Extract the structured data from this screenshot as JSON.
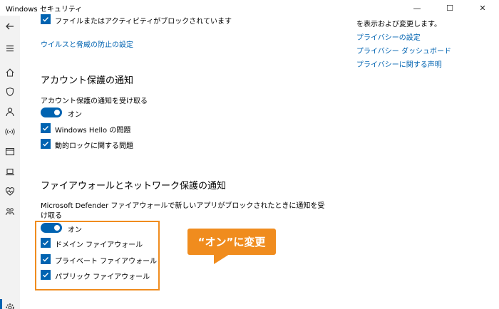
{
  "window": {
    "title": "Windows セキュリティ",
    "minimize": "—",
    "maximize": "☐",
    "close": "✕"
  },
  "top": {
    "blocked_activity_label": "ファイルまたはアクティビティがブロックされています",
    "virus_settings_link": "ウイルスと脅威の防止の設定"
  },
  "right_panel": {
    "description": "を表示および変更します。",
    "links": [
      "プライバシーの設定",
      "プライバシー ダッシュボード",
      "プライバシーに関する声明"
    ]
  },
  "account_section": {
    "heading": "アカウント保護の通知",
    "receive_label": "アカウント保護の通知を受け取る",
    "toggle_state": "オン",
    "items": [
      "Windows Hello の問題",
      "動的ロックに関する問題"
    ]
  },
  "firewall_section": {
    "heading": "ファイアウォールとネットワーク保護の通知",
    "description_line1": "Microsoft Defender ファイアウォールで新しいアプリがブロックされたときに通知を受",
    "description_line2": "け取る",
    "toggle_state": "オン",
    "items": [
      "ドメイン ファイアウォール",
      "プライベート ファイアウォール",
      "パブリック ファイアウォール"
    ]
  },
  "annotation": {
    "callout": "“オン”に変更",
    "highlight_color": "#f08c1e"
  },
  "colors": {
    "accent": "#0063b1",
    "sidebar_bg": "#f2f2f2"
  },
  "sidebar_icons": [
    "back-arrow-icon",
    "hamburger-menu-icon",
    "home-icon",
    "shield-icon",
    "person-icon",
    "wireless-icon",
    "app-browser-icon",
    "laptop-icon",
    "heart-icon",
    "family-icon",
    "gear-icon"
  ]
}
